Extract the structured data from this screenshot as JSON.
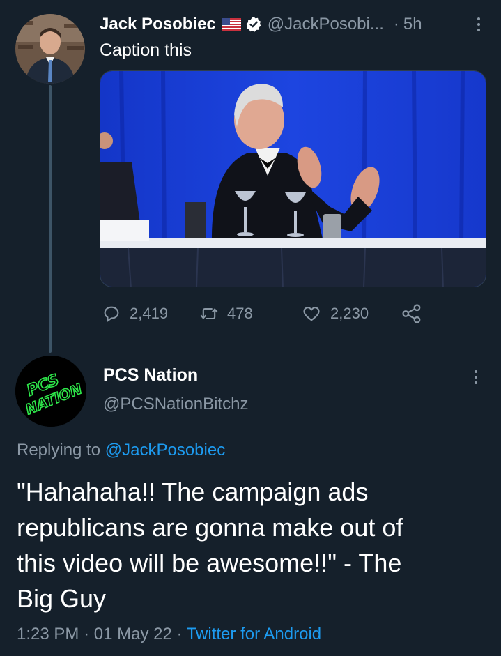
{
  "tweet1": {
    "display_name": "Jack Posobiec",
    "handle": "@JackPosobi...",
    "separator": "·",
    "time": "5h",
    "text": "Caption this",
    "stats": {
      "replies": "2,419",
      "retweets": "478",
      "likes": "2,230"
    },
    "icons": {
      "flag": "us-flag-icon",
      "verified": "verified-badge-icon",
      "more": "more-vertical-icon",
      "reply": "reply-icon",
      "retweet": "retweet-icon",
      "like": "heart-icon",
      "share": "share-icon"
    }
  },
  "tweet2": {
    "display_name": "PCS Nation",
    "handle": "@PCSNationBitchz",
    "avatar_text_line1": "PCS",
    "avatar_text_line2": "NATION",
    "replying_prefix": "Replying to",
    "replying_to": "@JackPosobiec",
    "body_lines": [
      "\"Hahahaha!! The campaign ads",
      "republicans are gonna make out of",
      "this video will be awesome!!\" - The",
      "Big Guy"
    ],
    "time": "1:23 PM",
    "date": "01 May 22",
    "dot1": "·",
    "dot2": "·",
    "source": "Twitter for Android"
  },
  "colors": {
    "background": "#15202b",
    "text_primary": "#ffffff",
    "text_secondary": "#8b98a5",
    "link": "#1d9bf0",
    "verified": "#ffffff",
    "avatar_logo": "#2ee84a"
  }
}
